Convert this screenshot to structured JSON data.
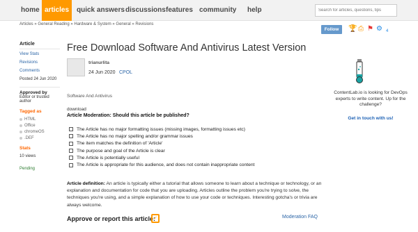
{
  "nav": {
    "home": "home",
    "articles": "articles",
    "quick_answers": "quick answers",
    "discussions": "discussions",
    "features": "features",
    "community": "community",
    "help": "help",
    "search_placeholder": "Search for articles, questions, tips"
  },
  "breadcrumb": "Articles » General Reading » Hardware & System » General » Revisions",
  "follow_label": "Follow",
  "sidebar": {
    "article_title": "Article",
    "view_stats": "View Stats",
    "revisions": "Revisions",
    "comments": "Comments",
    "posted": "Posted 24 Jun 2020",
    "approved_by": "Approved by",
    "approved_text": "Editor or trusted author",
    "tagged_as": "Tagged as",
    "tags": [
      "HTML",
      "Office",
      "chromeOS",
      ".DEF"
    ],
    "stats_heading": "Stats",
    "views": "10 views",
    "pending": "Pending"
  },
  "article": {
    "title": "Free Download Software And Antivirus Latest Version",
    "author": "trianurlita",
    "date": "24 Jun 2020",
    "license": "CPOL",
    "section": "Software And Antivirus",
    "body_word": "download",
    "moderation_question": "Article Moderation: Should this article be published?",
    "checklist": [
      "The Article has no major formatting issues (missing images, formatting issues etc)",
      "The Article has no major spelling and/or grammar issues",
      "The item matches the definition of 'Article'",
      "The purpose and goal of the Article is clear",
      "The Article is potentially useful",
      "The Article is appropriate for this audience, and does not contain inappropriate content"
    ],
    "definition_label": "Article definition:",
    "definition_text": "An article is typically either a tutorial that allows someone to learn about a technique or technology, or an explanation and documentation for code that you are uploading. Articles outline the problem you're trying to solve, the techniques you're using, and a simple explanation of how to use your code or techniques. Interesting gotcha's or trivia are always welcome.",
    "approve_label": "Approve or report this article:",
    "moderation_faq": "Moderation FAQ"
  },
  "ad": {
    "text": "ContentLab.io is looking for DevOps experts to write content. Up for the challenge?",
    "link": "Get in touch with us!"
  },
  "colors": {
    "accent": "#ff9900",
    "link": "#2a64a6",
    "follow": "#6699cc",
    "heading_orange": "#ff6600"
  }
}
